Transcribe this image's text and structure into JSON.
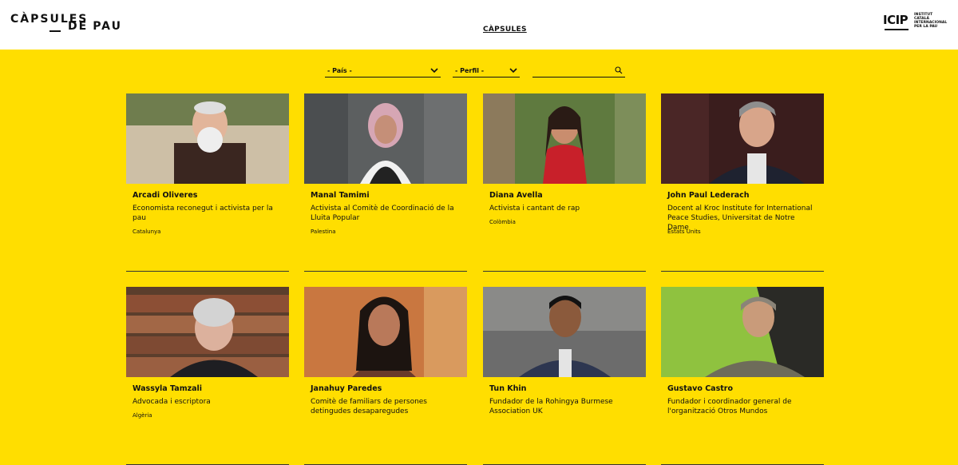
{
  "header": {
    "logo_line1": "CÀPSULES",
    "logo_line2_a": "DE",
    "logo_line2_b": "PAU",
    "nav_label": "CÀPSULES",
    "icip_big": "ICIP",
    "icip_small": "INSTITUT CATALÀ INTERNACIONAL PER LA PAU"
  },
  "filters": {
    "country_label": "- País -",
    "profile_label": "- Perfil -",
    "search_value": ""
  },
  "colors": {
    "background": "#ffde00",
    "header_bg": "#ffffff",
    "text": "#111111"
  },
  "people": [
    {
      "name": "Arcadi Oliveres",
      "role": "Economista reconegut i activista per la pau",
      "country": "Catalunya"
    },
    {
      "name": "Manal Tamimi",
      "role": "Activista al Comitè de Coordinació de la Lluita Popular",
      "country": "Palestina"
    },
    {
      "name": "Diana Avella",
      "role": "Activista i cantant de rap",
      "country": "Colòmbia"
    },
    {
      "name": "John Paul Lederach",
      "role": "Docent al Kroc Institute for International Peace Studies, Universitat de Notre Dame",
      "country": "Estats Units"
    },
    {
      "name": "Wassyla Tamzali",
      "role": "Advocada i escriptora",
      "country": "Algèria"
    },
    {
      "name": "Janahuy Paredes",
      "role": "Comitè de familiars de persones detingudes desaparegudes",
      "country": ""
    },
    {
      "name": "Tun Khin",
      "role": "Fundador de la Rohingya Burmese Association UK",
      "country": ""
    },
    {
      "name": "Gustavo Castro",
      "role": "Fundador i coordinador general de l'organització Otros Mundos",
      "country": ""
    }
  ]
}
